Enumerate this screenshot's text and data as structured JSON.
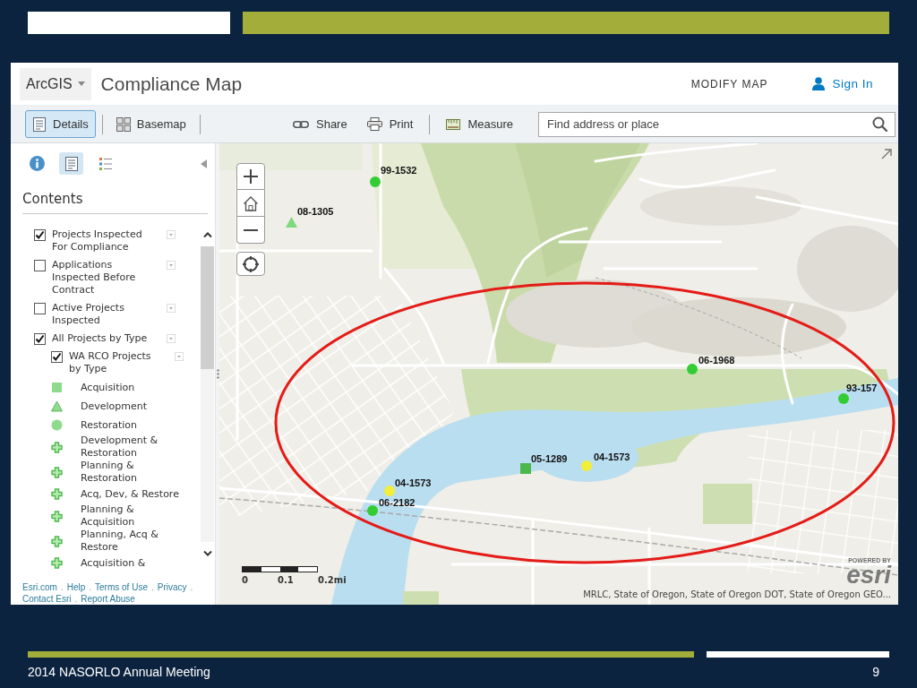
{
  "slide": {
    "footer": "2014 NASORLO Annual Meeting",
    "page_number": "9"
  },
  "app": {
    "header": {
      "product_menu": "ArcGIS",
      "title": "Compliance Map",
      "modify_map": "MODIFY MAP",
      "sign_in": "Sign In"
    },
    "toolbar": {
      "panels": [
        {
          "kind": "details",
          "label": "Details",
          "selected": true
        },
        {
          "kind": "basemap",
          "label": "Basemap",
          "selected": false
        }
      ],
      "actions": [
        {
          "kind": "share",
          "label": "Share"
        },
        {
          "kind": "print",
          "label": "Print"
        },
        {
          "kind": "measure",
          "label": "Measure"
        }
      ],
      "search": {
        "placeholder": "Find address or place"
      }
    },
    "sidebar": {
      "tabs": [
        {
          "kind": "about",
          "selected": false
        },
        {
          "kind": "content",
          "selected": true
        },
        {
          "kind": "legend",
          "selected": false
        }
      ],
      "heading": "Contents",
      "layers": [
        {
          "label": "Projects Inspected For Compliance",
          "checked": true
        },
        {
          "label": "Applications Inspected Before Contract",
          "checked": false
        },
        {
          "label": "Active Projects Inspected",
          "checked": false
        },
        {
          "label": "All Projects by Type",
          "checked": true,
          "children": [
            {
              "label": "WA RCO Projects by Type",
              "checked": true,
              "legend": [
                {
                  "kind": "square",
                  "label": "Acquisition"
                },
                {
                  "kind": "triangle",
                  "label": "Development"
                },
                {
                  "kind": "circle",
                  "label": "Restoration"
                },
                {
                  "kind": "cross",
                  "label": "Development & Restoration"
                },
                {
                  "kind": "cross",
                  "label": "Planning & Restoration"
                },
                {
                  "kind": "cross",
                  "label": "Acq, Dev, & Restore"
                },
                {
                  "kind": "cross",
                  "label": "Planning & Acquisition"
                },
                {
                  "kind": "cross",
                  "label": "Planning, Acq & Restore"
                },
                {
                  "kind": "cross",
                  "label": "Acquisition &"
                }
              ]
            }
          ]
        }
      ],
      "footer_links": [
        [
          {
            "label": "Esri.com",
            "separator": "."
          },
          {
            "label": "Help",
            "separator": "."
          },
          {
            "label": "Terms of Use",
            "separator": "."
          },
          {
            "label": "Privacy",
            "separator": "."
          }
        ],
        [
          {
            "label": "Contact Esri",
            "separator": "."
          },
          {
            "label": "Report Abuse"
          }
        ]
      ]
    },
    "map": {
      "markers": [
        {
          "label": "99-1532",
          "kind": "circle",
          "color": "#33cc33"
        },
        {
          "label": "08-1305",
          "kind": "triangle",
          "color": "#7ed87e"
        },
        {
          "label": "06-1968",
          "kind": "circle",
          "color": "#33cc33"
        },
        {
          "label": "93-157",
          "kind": "circle",
          "color": "#33cc33"
        },
        {
          "label": "05-1289",
          "kind": "square",
          "color": "#4cb84c"
        },
        {
          "label": "04-1573",
          "kind": "circle",
          "color": "#f2ee3a"
        },
        {
          "label": "04-1573",
          "kind": "circle",
          "color": "#f2ee3a"
        },
        {
          "label": "06-2182",
          "kind": "circle",
          "color": "#33cc33"
        }
      ],
      "scale_bar": {
        "labels": [
          "0",
          "0.1",
          "0.2mi"
        ]
      },
      "attribution": "MRLC, State of Oregon, State of Oregon DOT, State of Oregon GEO...",
      "logo": {
        "caption": "POWERED BY",
        "wordmark": "esri"
      }
    }
  }
}
